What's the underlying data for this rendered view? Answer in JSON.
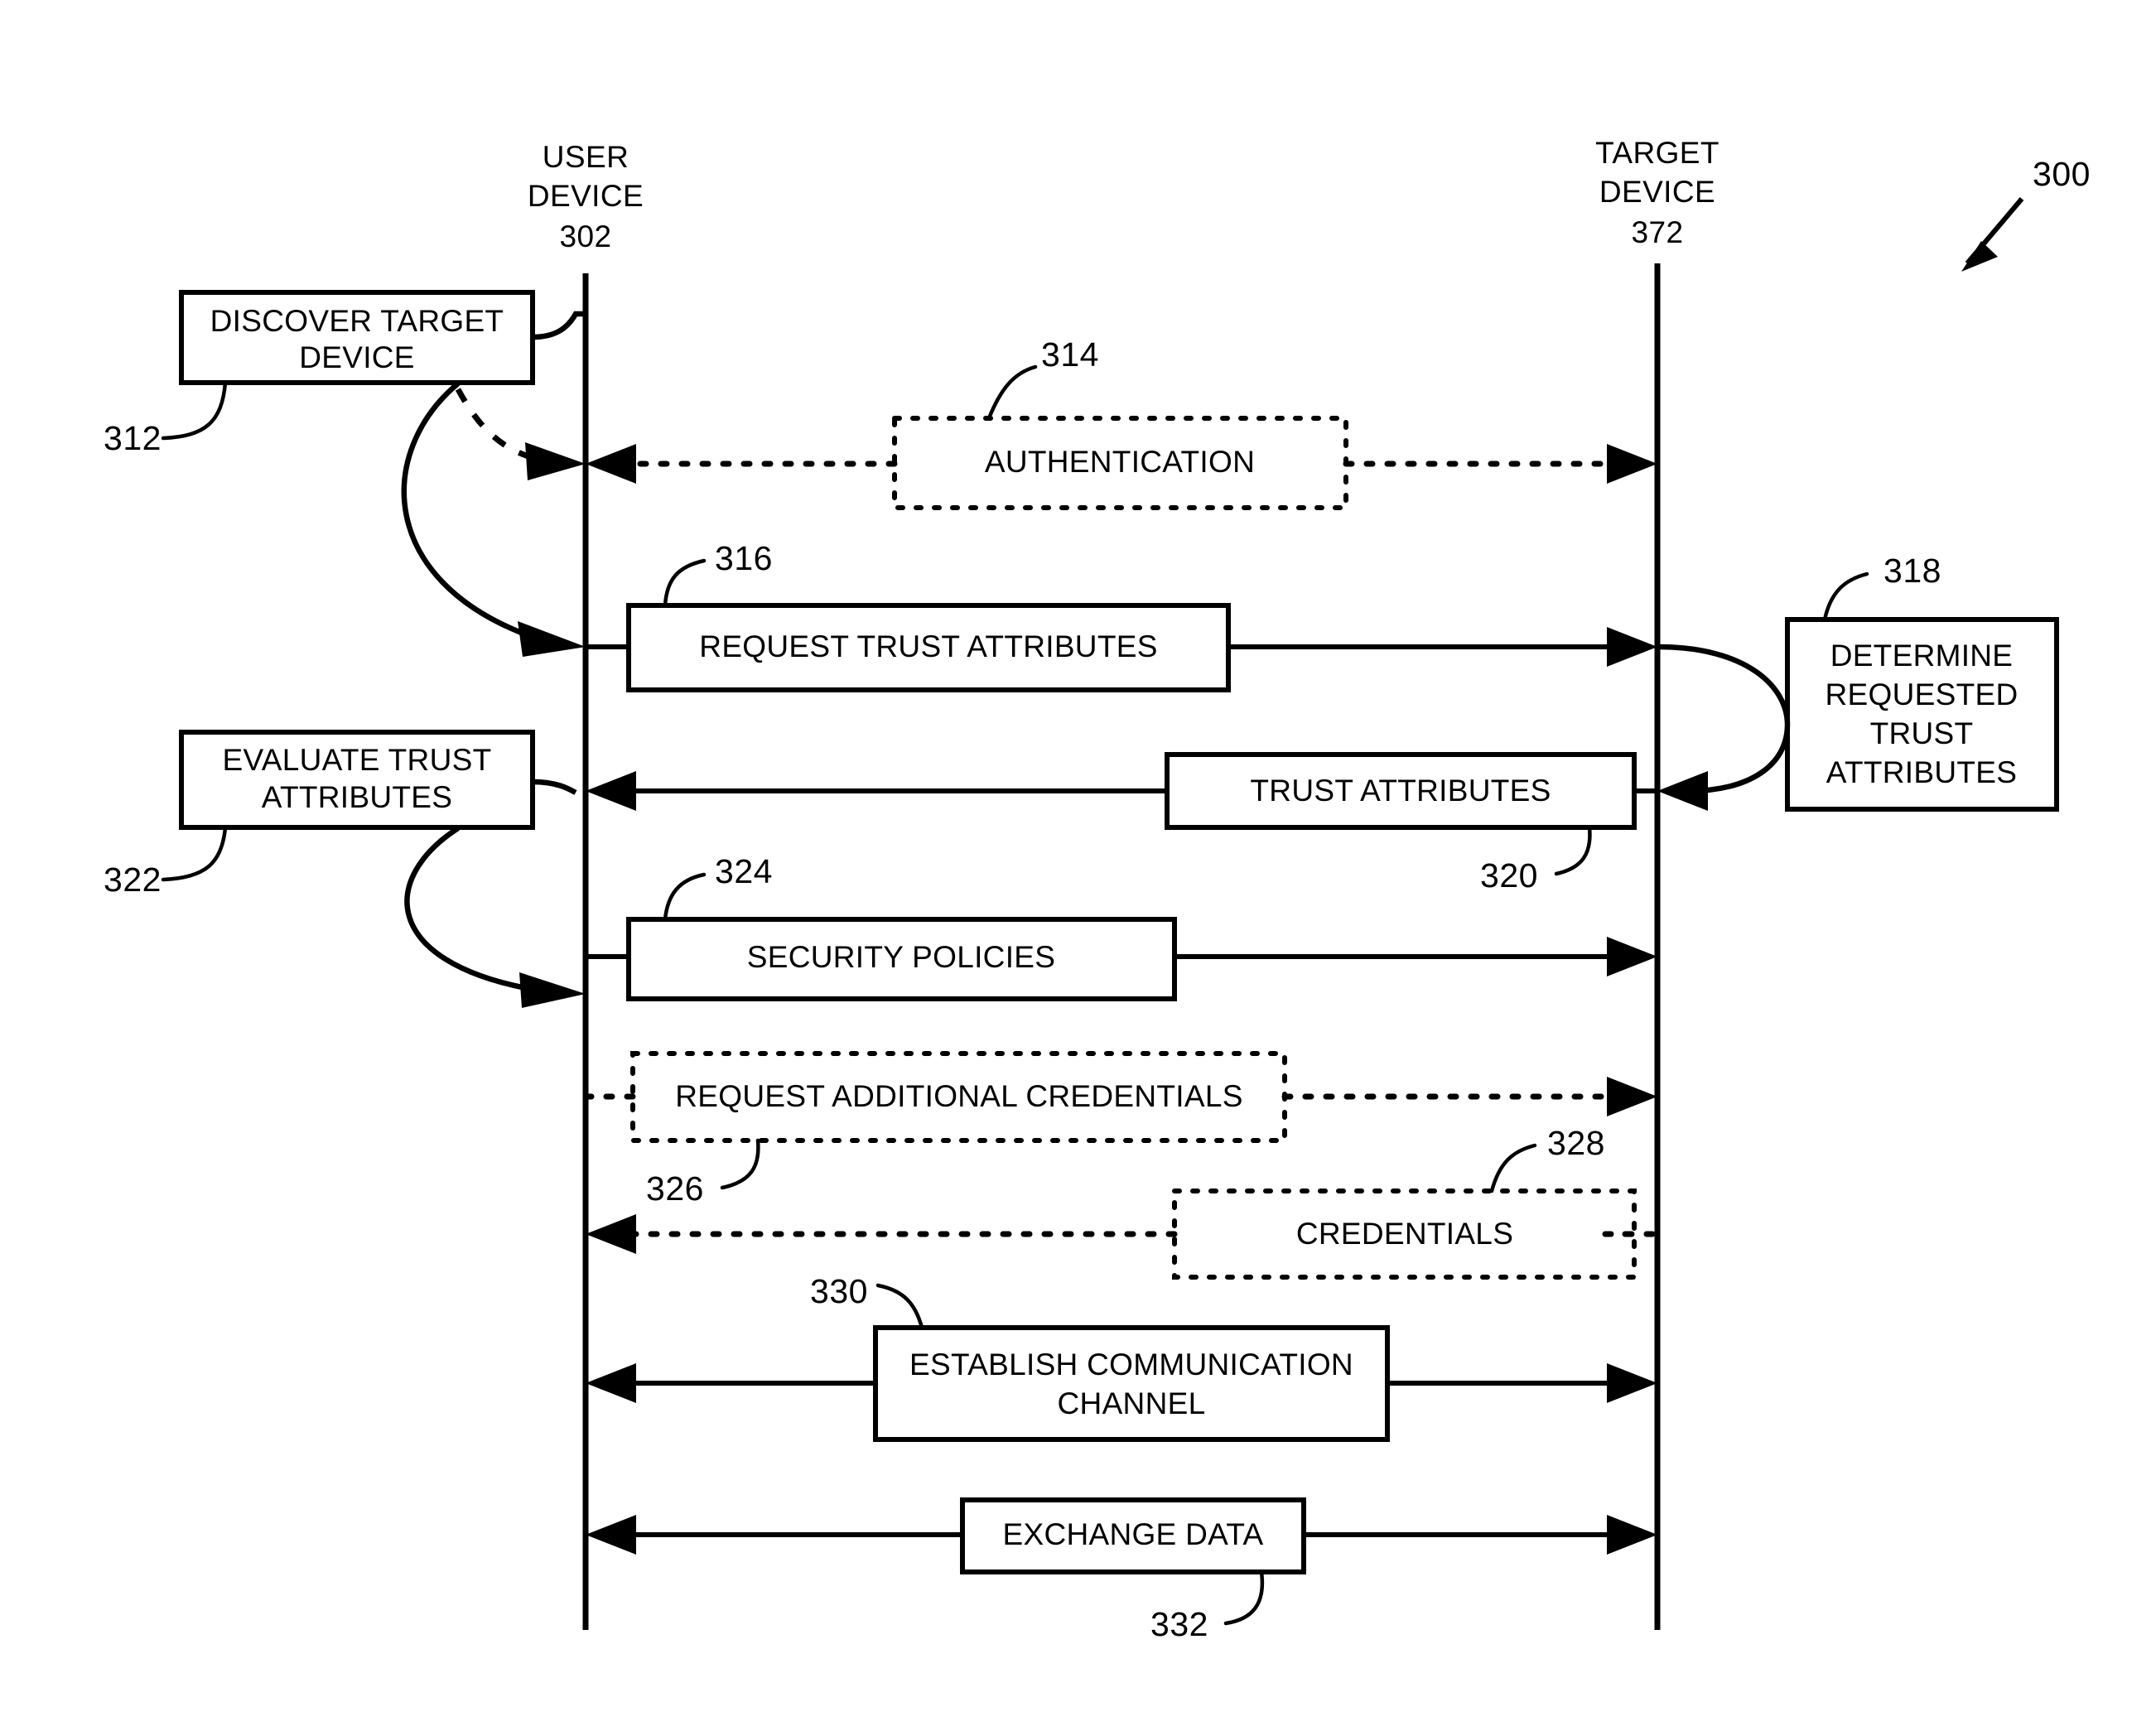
{
  "figure": {
    "number": "300",
    "type": "sequence-diagram"
  },
  "lifelines": [
    {
      "id": "user-device",
      "name_line1": "USER",
      "name_line2": "DEVICE",
      "ref": "302"
    },
    {
      "id": "target-device",
      "name_line1": "TARGET",
      "name_line2": "DEVICE",
      "ref": "372"
    }
  ],
  "process_boxes": [
    {
      "id": "discover-target-device",
      "line1": "DISCOVER TARGET",
      "line2": "DEVICE",
      "ref": "312",
      "style": "solid",
      "side": "user"
    },
    {
      "id": "determine-requested-trust-attributes",
      "line1": "DETERMINE",
      "line2": "REQUESTED",
      "line3": "TRUST",
      "line4": "ATTRIBUTES",
      "ref": "318",
      "style": "solid",
      "side": "target"
    },
    {
      "id": "evaluate-trust-attributes",
      "line1": "EVALUATE TRUST",
      "line2": "ATTRIBUTES",
      "ref": "322",
      "style": "solid",
      "side": "user"
    }
  ],
  "messages": [
    {
      "id": "authentication",
      "label": "AUTHENTICATION",
      "ref": "314",
      "style": "dashed",
      "direction": "bidirectional"
    },
    {
      "id": "request-trust-attributes",
      "label": "REQUEST TRUST ATTRIBUTES",
      "ref": "316",
      "style": "solid",
      "direction": "user-to-target"
    },
    {
      "id": "trust-attributes",
      "label": "TRUST ATTRIBUTES",
      "ref": "320",
      "style": "solid",
      "direction": "target-to-user"
    },
    {
      "id": "security-policies",
      "label": "SECURITY POLICIES",
      "ref": "324",
      "style": "solid",
      "direction": "user-to-target"
    },
    {
      "id": "request-additional-credentials",
      "label": "REQUEST ADDITIONAL CREDENTIALS",
      "ref": "326",
      "style": "dashed",
      "direction": "user-to-target"
    },
    {
      "id": "credentials",
      "label": "CREDENTIALS",
      "ref": "328",
      "style": "dashed",
      "direction": "target-to-user"
    },
    {
      "id": "establish-communication-channel",
      "label_line1": "ESTABLISH COMMUNICATION",
      "label_line2": "CHANNEL",
      "ref": "330",
      "style": "solid",
      "direction": "bidirectional"
    },
    {
      "id": "exchange-data",
      "label": "EXCHANGE DATA",
      "ref": "332",
      "style": "solid",
      "direction": "bidirectional"
    }
  ]
}
